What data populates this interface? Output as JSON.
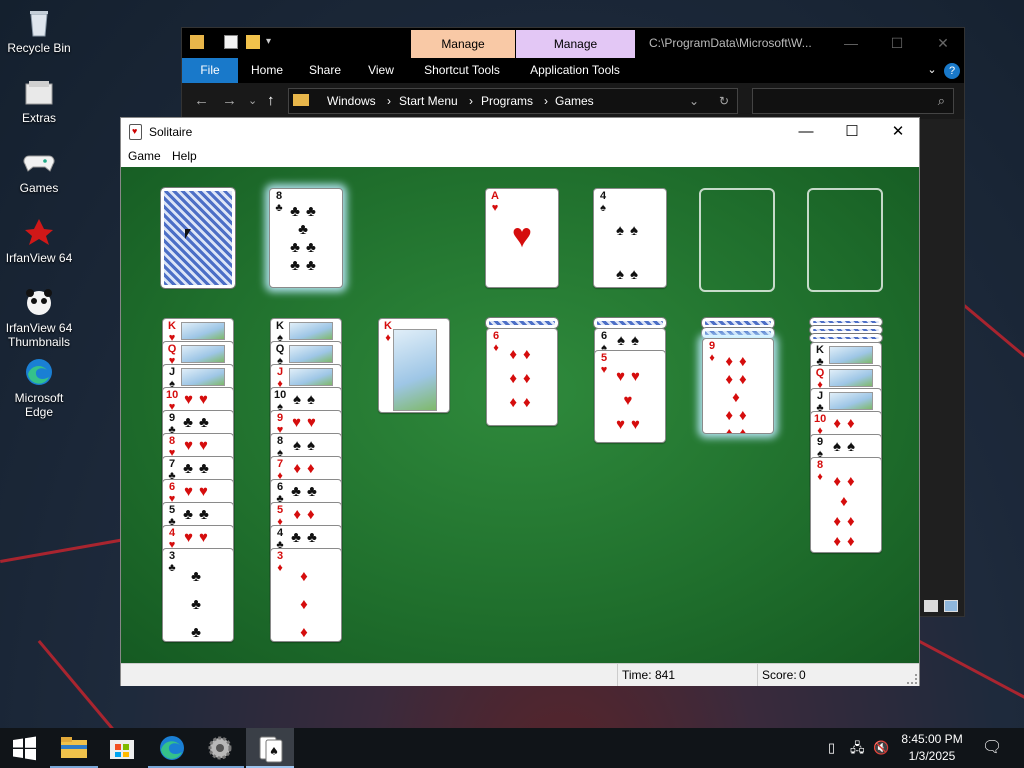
{
  "desktop": {
    "icons": [
      {
        "label": "Recycle Bin",
        "icon": "recycle-bin-icon"
      },
      {
        "label": "Extras",
        "icon": "folder-icon"
      },
      {
        "label": "Games",
        "icon": "gamepad-icon"
      },
      {
        "label": "IrfanView 64",
        "icon": "irfanview-icon"
      },
      {
        "label": "IrfanView 64 Thumbnails",
        "icon": "irfanview-thumbnails-icon"
      },
      {
        "label": "Microsoft Edge",
        "icon": "edge-icon"
      }
    ]
  },
  "explorer": {
    "path": "C:\\ProgramData\\Microsoft\\W...",
    "context_tabs": [
      "Manage",
      "Manage"
    ],
    "ribbon_tabs": [
      "File",
      "Home",
      "Share",
      "View",
      "Shortcut Tools",
      "Application Tools"
    ],
    "breadcrumb": [
      "Windows",
      "Start Menu",
      "Programs",
      "Games"
    ],
    "context_colors": [
      "#f9c9a6",
      "#e3c7f5"
    ],
    "file_tab_color": "#1979ca"
  },
  "solitaire": {
    "title": "Solitaire",
    "menu": [
      "Game",
      "Help"
    ],
    "status": {
      "time_label": "Time:",
      "time_value": "841",
      "score_label": "Score:",
      "score_value": "0"
    },
    "felt_color": "#1f6e2c"
  },
  "taskbar": {
    "clock_time": "8:45:00 PM",
    "clock_date": "1/3/2025",
    "apps": [
      "start-icon",
      "file-explorer-icon",
      "store-icon",
      "edge-icon",
      "settings-gear-icon",
      "solitaire-icon"
    ]
  }
}
